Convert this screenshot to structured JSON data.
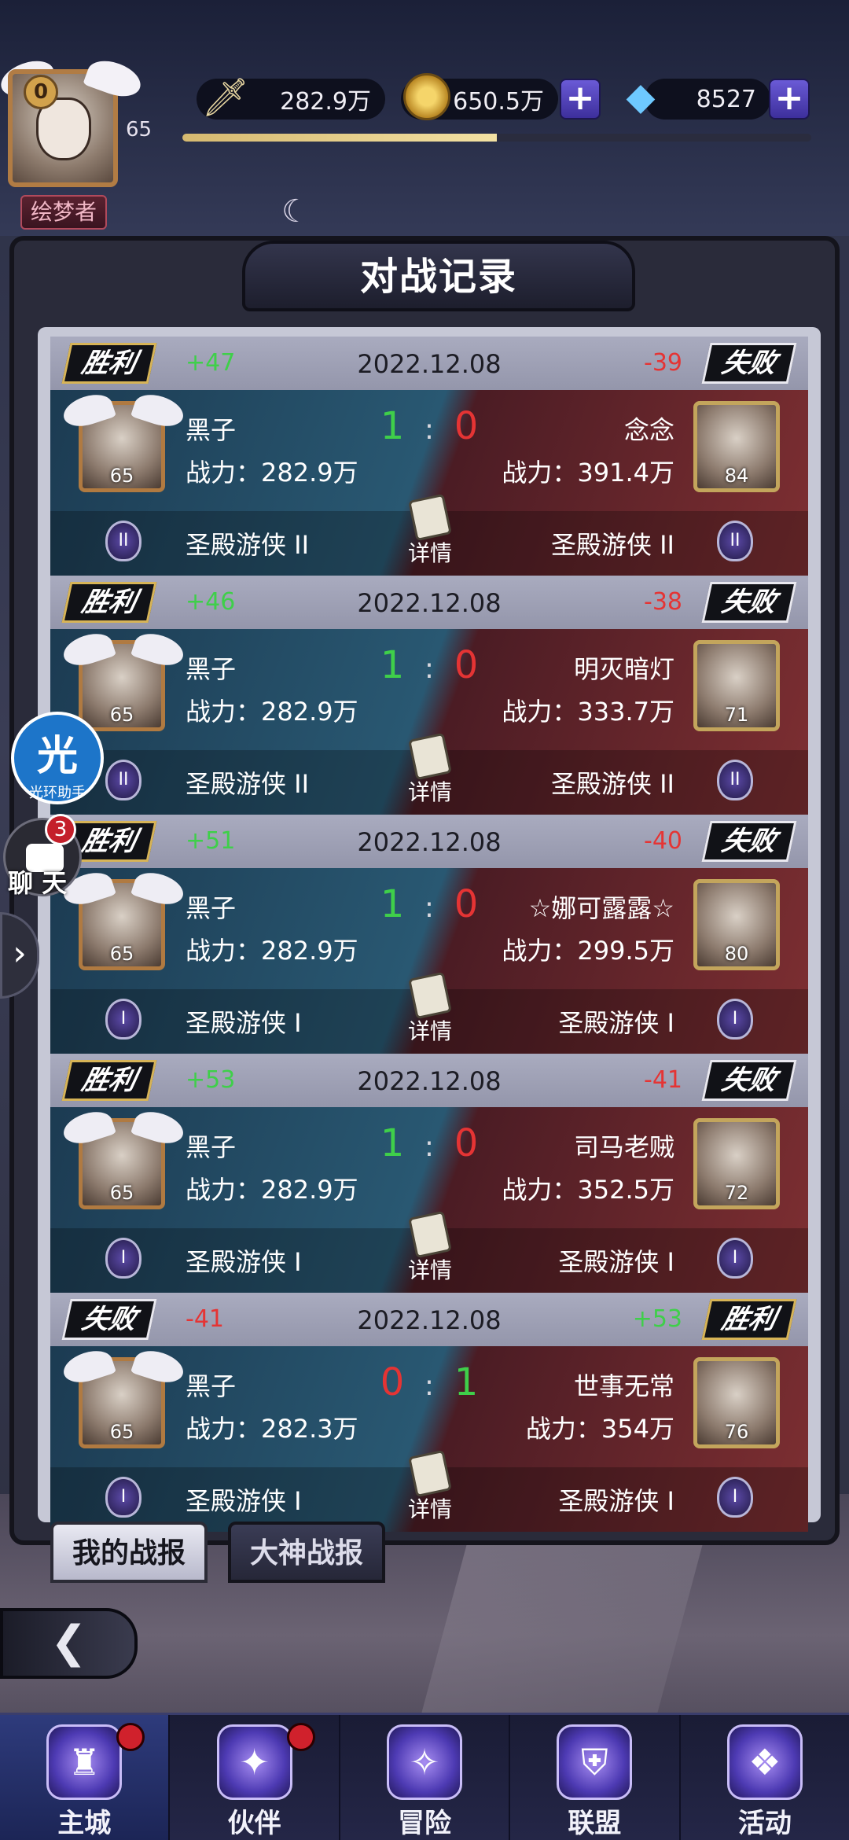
{
  "top": {
    "vip_level": "0",
    "player_level": "65",
    "player_title": "绘梦者",
    "power": "282.9万",
    "gold": "650.5万",
    "diamonds": "8527",
    "xp_fraction": 0.5
  },
  "panel": {
    "title": "对战记录"
  },
  "records": [
    {
      "left_result": "胜利",
      "left_points": "+47",
      "date": "2022.12.08",
      "right_points": "-39",
      "right_result": "失败",
      "left_name": "黑子",
      "left_power": "战力：282.9万",
      "left_level": "65",
      "score_left": "1",
      "score_sep": ":",
      "score_right": "0",
      "right_name": "念念",
      "right_power": "战力：391.4万",
      "right_level": "84",
      "left_rank": "圣殿游侠 II",
      "right_rank": "圣殿游侠 II",
      "detail": "详情",
      "rank_numeral": "II"
    },
    {
      "left_result": "胜利",
      "left_points": "+46",
      "date": "2022.12.08",
      "right_points": "-38",
      "right_result": "失败",
      "left_name": "黑子",
      "left_power": "战力：282.9万",
      "left_level": "65",
      "score_left": "1",
      "score_sep": ":",
      "score_right": "0",
      "right_name": "明灭暗灯",
      "right_power": "战力：333.7万",
      "right_level": "71",
      "left_rank": "圣殿游侠 II",
      "right_rank": "圣殿游侠 II",
      "detail": "详情",
      "rank_numeral": "II"
    },
    {
      "left_result": "胜利",
      "left_points": "+51",
      "date": "2022.12.08",
      "right_points": "-40",
      "right_result": "失败",
      "left_name": "黑子",
      "left_power": "战力：282.9万",
      "left_level": "65",
      "score_left": "1",
      "score_sep": ":",
      "score_right": "0",
      "right_name": "☆娜可露露☆",
      "right_power": "战力：299.5万",
      "right_level": "80",
      "left_rank": "圣殿游侠 I",
      "right_rank": "圣殿游侠 I",
      "detail": "详情",
      "rank_numeral": "I"
    },
    {
      "left_result": "胜利",
      "left_points": "+53",
      "date": "2022.12.08",
      "right_points": "-41",
      "right_result": "失败",
      "left_name": "黑子",
      "left_power": "战力：282.9万",
      "left_level": "65",
      "score_left": "1",
      "score_sep": ":",
      "score_right": "0",
      "right_name": "司马老贼",
      "right_power": "战力：352.5万",
      "right_level": "72",
      "left_rank": "圣殿游侠 I",
      "right_rank": "圣殿游侠 I",
      "detail": "详情",
      "rank_numeral": "I"
    },
    {
      "left_result": "失败",
      "left_points": "-41",
      "date": "2022.12.08",
      "right_points": "+53",
      "right_result": "胜利",
      "left_name": "黑子",
      "left_power": "战力：282.3万",
      "left_level": "65",
      "score_left": "0",
      "score_sep": ":",
      "score_right": "1",
      "right_name": "世事无常",
      "right_power": "战力：354万",
      "right_level": "76",
      "left_rank": "圣殿游侠 I",
      "right_rank": "圣殿游侠 I",
      "detail": "详情",
      "rank_numeral": "I"
    }
  ],
  "tabs": {
    "my_reports": "我的战报",
    "expert_reports": "大神战报"
  },
  "widgets": {
    "helper_big": "光",
    "helper_small": "光环助手",
    "chat_badge": "3",
    "chat_label": "聊 天"
  },
  "nav": [
    {
      "label": "主城",
      "icon": "castle-icon",
      "dot": true
    },
    {
      "label": "伙伴",
      "icon": "wizard-hat-icon",
      "dot": true
    },
    {
      "label": "冒险",
      "icon": "compass-icon",
      "dot": false
    },
    {
      "label": "联盟",
      "icon": "shield-icon",
      "dot": false
    },
    {
      "label": "活动",
      "icon": "cards-icon",
      "dot": false
    }
  ],
  "colors": {
    "win_points": "#3fcf4a",
    "lose_points": "#e53434",
    "gold_tag_border": "#d7b457"
  }
}
